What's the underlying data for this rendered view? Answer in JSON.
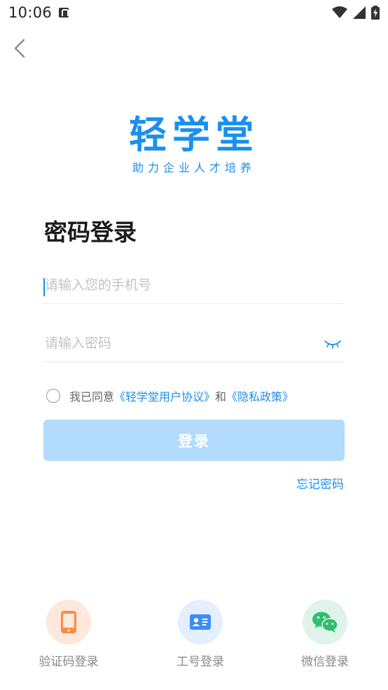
{
  "status_bar": {
    "time": "10:06"
  },
  "logo": {
    "title": "轻学堂",
    "slogan": "助力企业人才培养"
  },
  "page_title": "密码登录",
  "phone_input": {
    "placeholder": "请输入您的手机号",
    "value": ""
  },
  "password_input": {
    "placeholder": "请输入密码",
    "value": ""
  },
  "agreement": {
    "prefix": "我已同意",
    "user_agreement": "《轻学堂用户协议》",
    "and": "和",
    "privacy_policy": "《隐私政策》"
  },
  "login_button": "登录",
  "forgot_password": "忘记密码",
  "alt_logins": [
    {
      "label": "验证码登录",
      "icon": "phone-icon"
    },
    {
      "label": "工号登录",
      "icon": "id-card-icon"
    },
    {
      "label": "微信登录",
      "icon": "wechat-icon"
    }
  ],
  "colors": {
    "accent": "#1a8ff0",
    "button_disabled": "#b3dbfd"
  }
}
